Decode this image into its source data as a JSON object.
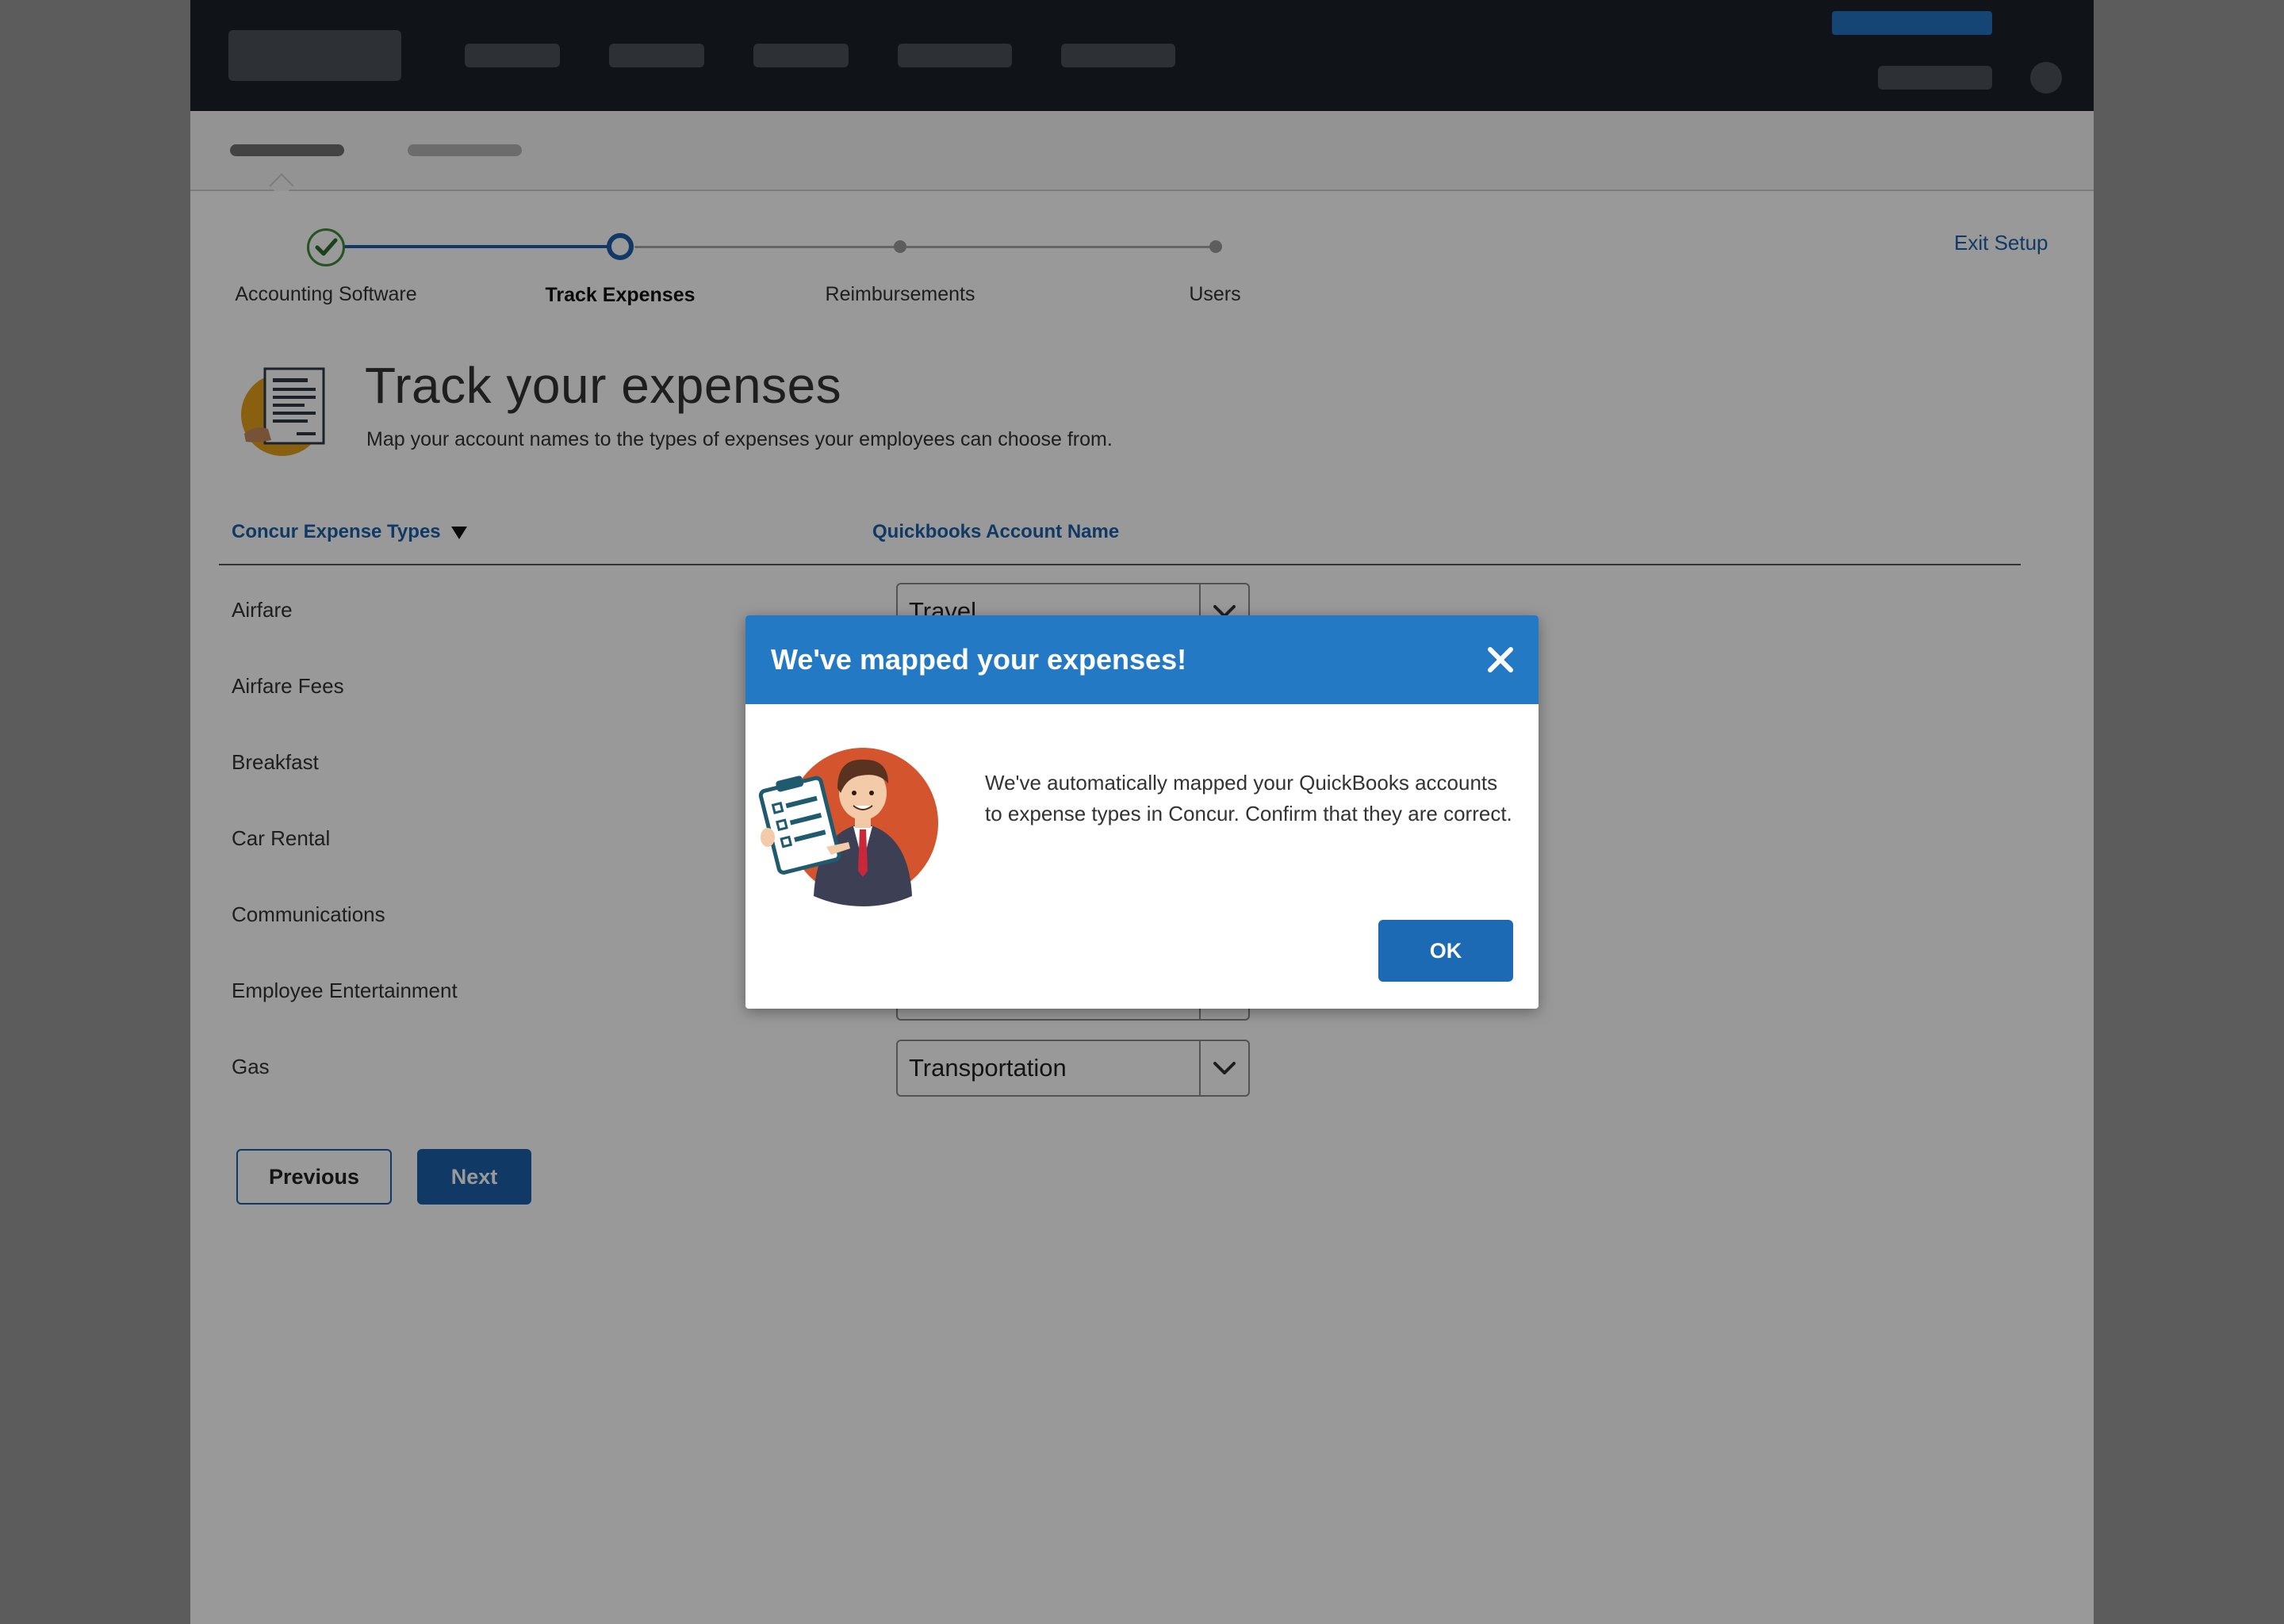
{
  "stepper": {
    "steps": [
      {
        "label": "Accounting Software",
        "state": "complete"
      },
      {
        "label": "Track Expenses",
        "state": "current"
      },
      {
        "label": "Reimbursements",
        "state": "upcoming"
      },
      {
        "label": "Users",
        "state": "upcoming"
      }
    ],
    "exit_label": "Exit Setup"
  },
  "header": {
    "title": "Track your expenses",
    "subtitle": "Map your account names to the types of expenses your employees can choose from.",
    "icon": "expense-report-icon"
  },
  "table": {
    "col_expense_types": "Concur Expense Types",
    "col_account_name": "Quickbooks Account Name",
    "rows": [
      {
        "label": "Airfare",
        "account": "Travel"
      },
      {
        "label": "Airfare Fees",
        "account": ""
      },
      {
        "label": "Breakfast",
        "account": ""
      },
      {
        "label": "Car Rental",
        "account": ""
      },
      {
        "label": "Communications",
        "account": ""
      },
      {
        "label": "Employee Entertainment",
        "account": ""
      },
      {
        "label": "Gas",
        "account": "Transportation"
      }
    ]
  },
  "actions": {
    "previous_label": "Previous",
    "next_label": "Next"
  },
  "modal": {
    "title": "We've mapped your expenses!",
    "body": "We've automatically mapped your QuickBooks accounts to expense types in Concur. Confirm that they are correct.",
    "ok_label": "OK",
    "illustration": "businessman-with-checklist-illustration"
  },
  "colors": {
    "topbar": "#1b222a",
    "brand_blue": "#1b61a8",
    "modal_header": "#2479c4",
    "complete_green": "#3f8a3a"
  }
}
